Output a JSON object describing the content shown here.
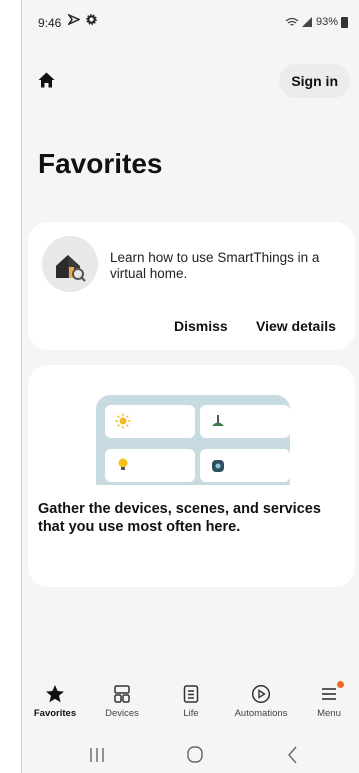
{
  "status_bar": {
    "time": "9:46",
    "battery": "93%"
  },
  "header": {
    "sign_in_label": "Sign in",
    "title": "Favorites"
  },
  "intro_card": {
    "text": "Learn how to use SmartThings in a virtual home.",
    "dismiss_label": "Dismiss",
    "view_details_label": "View details"
  },
  "empty_card": {
    "text": "Gather the devices, scenes, and services that you use most often here."
  },
  "bottom_nav": {
    "items": [
      {
        "label": "Favorites",
        "icon": "star-icon",
        "active": true
      },
      {
        "label": "Devices",
        "icon": "devices-icon",
        "active": false
      },
      {
        "label": "Life",
        "icon": "life-icon",
        "active": false
      },
      {
        "label": "Automations",
        "icon": "automations-icon",
        "active": false
      },
      {
        "label": "Menu",
        "icon": "menu-icon",
        "active": false,
        "badge": true
      }
    ]
  },
  "colors": {
    "background": "#f5f5f5",
    "card": "#ffffff",
    "illustration_panel": "#c7dbe0",
    "badge": "#f06a1e"
  }
}
